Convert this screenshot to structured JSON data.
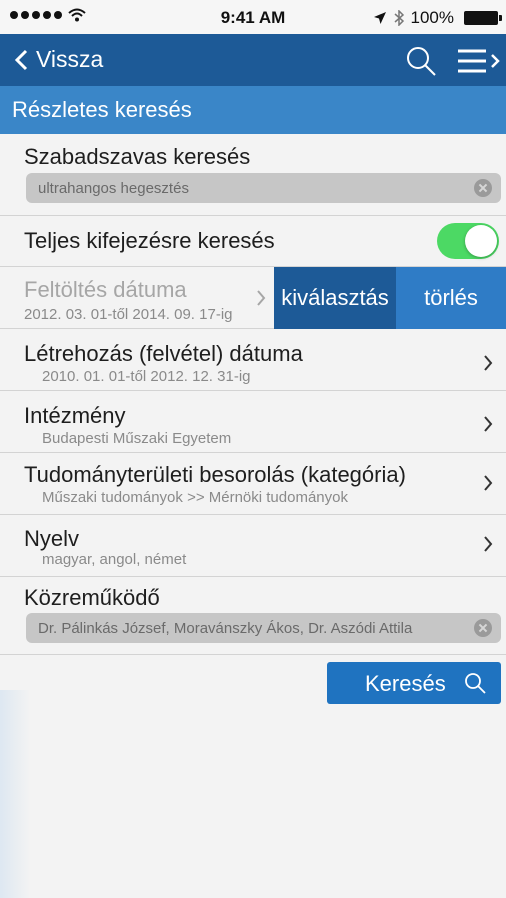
{
  "status_bar": {
    "time": "9:41 AM",
    "battery": "100%",
    "signal_icon": "signal-dots-icon",
    "wifi_icon": "wifi-icon",
    "location_icon": "location-arrow-icon",
    "bluetooth_icon": "bluetooth-icon",
    "battery_icon": "battery-icon"
  },
  "nav": {
    "back_label": "Vissza",
    "search_icon": "search-icon",
    "menu_icon": "hamburger-menu-icon",
    "color": "#1d5a97"
  },
  "section": {
    "title": "Részletes keresés",
    "color": "#3a86c8"
  },
  "free_text": {
    "label": "Szabadszavas keresés",
    "value": "ultrahangos hegesztés"
  },
  "exact_phrase": {
    "label": "Teljes kifejezésre keresés",
    "toggle_on": true,
    "toggle_color": "#4cd964"
  },
  "upload_date": {
    "label": "Feltöltés dátuma",
    "value": "2012. 03. 01-től 2014. 09. 17-ig",
    "select_label": "kiválasztás",
    "delete_label": "törlés",
    "select_color": "#1d5a97",
    "delete_color": "#2f7cc6"
  },
  "created_date": {
    "label": "Létrehozás (felvétel) dátuma",
    "value": "2010. 01. 01-től 2012. 12. 31-ig"
  },
  "institution": {
    "label": "Intézmény",
    "value": "Budapesti Műszaki Egyetem"
  },
  "category": {
    "label": "Tudományterületi besorolás (kategória)",
    "value": "Műszaki tudományok >> Mérnöki tudományok"
  },
  "language": {
    "label": "Nyelv",
    "value": "magyar, angol, német"
  },
  "contributor": {
    "label": "Közreműködő",
    "value": "Dr. Pálinkás József, Moravánszky Ákos, Dr. Aszódi Attila"
  },
  "search_button": {
    "label": "Keresés",
    "color": "#1f73c0"
  }
}
